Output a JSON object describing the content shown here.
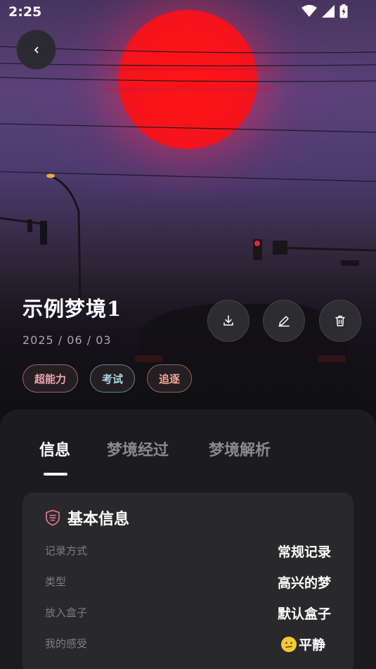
{
  "status_bar": {
    "time": "2:25"
  },
  "dream": {
    "title": "示例梦境1",
    "date": "2025 / 06 / 03",
    "tags": [
      {
        "label": "超能力",
        "color": "#f2a3b5",
        "border": "#a9606f"
      },
      {
        "label": "考试",
        "color": "#a8d8e6",
        "border": "#5f8794"
      },
      {
        "label": "追逐",
        "color": "#f2a894",
        "border": "#9a6558"
      }
    ]
  },
  "tabs": [
    {
      "label": "信息",
      "active": true
    },
    {
      "label": "梦境经过",
      "active": false
    },
    {
      "label": "梦境解析",
      "active": false
    }
  ],
  "info_card": {
    "title": "基本信息",
    "rows": [
      {
        "label": "记录方式",
        "value": "常规记录"
      },
      {
        "label": "类型",
        "value": "高兴的梦"
      },
      {
        "label": "放入盒子",
        "value": "默认盒子"
      },
      {
        "label": "我的感受",
        "value": "平静",
        "emoji": "calm-face"
      }
    ]
  },
  "colors": {
    "accent_title_icon": "#e87d8e",
    "sheet_background": "#1c1c1f",
    "card_background": "#29292c"
  }
}
